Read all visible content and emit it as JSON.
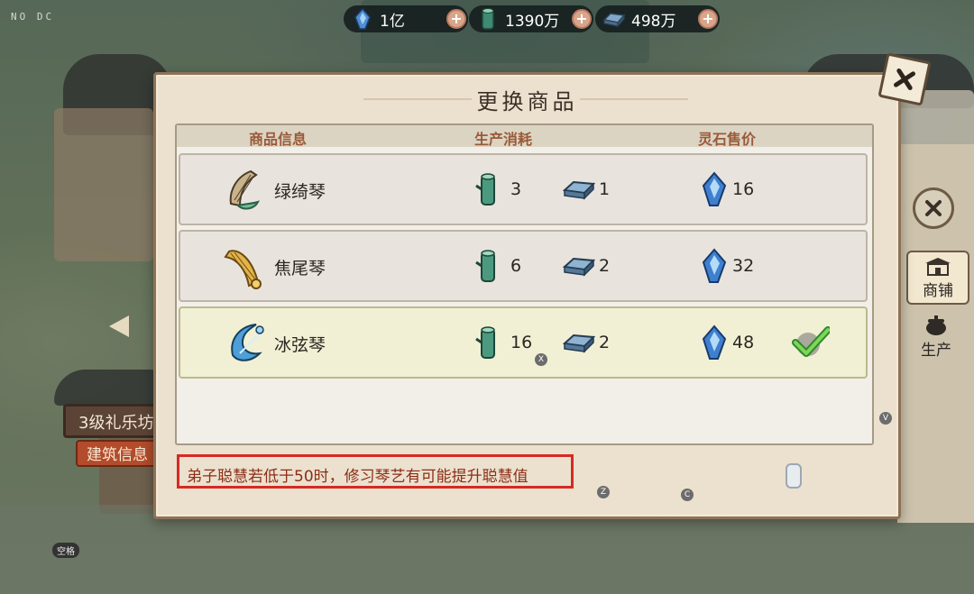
{
  "hud": {
    "corner_tag": "NO DC",
    "space_key": "空格"
  },
  "resources": [
    {
      "icon": "spirit-stone-icon",
      "value": "1亿"
    },
    {
      "icon": "wood-icon",
      "value": "1390万"
    },
    {
      "icon": "iron-ingot-icon",
      "value": "498万"
    }
  ],
  "dialog": {
    "title": "更换商品",
    "headers": {
      "info": "商品信息",
      "cost": "生产消耗",
      "price": "灵石售价"
    },
    "items": [
      {
        "name": "绿绮琴",
        "icon": "green-zither-icon",
        "wood": "3",
        "stone": "1",
        "price": "16",
        "selected": false
      },
      {
        "name": "焦尾琴",
        "icon": "jiaowei-zither-icon",
        "wood": "6",
        "stone": "2",
        "price": "32",
        "selected": false
      },
      {
        "name": "冰弦琴",
        "icon": "ice-zither-icon",
        "wood": "16",
        "stone": "2",
        "price": "48",
        "selected": true
      }
    ],
    "tip": "弟子聪慧若低于50时，修习琴艺有可能提升聪慧值"
  },
  "background_building": {
    "level_label": "3级礼乐坊",
    "build_label": "建筑信息"
  },
  "side_tabs": {
    "shop": "商铺",
    "production": "生产"
  },
  "key_hints": {
    "x": "X",
    "z": "Z",
    "c": "C",
    "v": "V"
  },
  "colors": {
    "accent_text": "#9a5a38",
    "tip_border": "#d52a22",
    "tip_text": "#8d2d16",
    "selected_row": "#f1f0d4"
  }
}
